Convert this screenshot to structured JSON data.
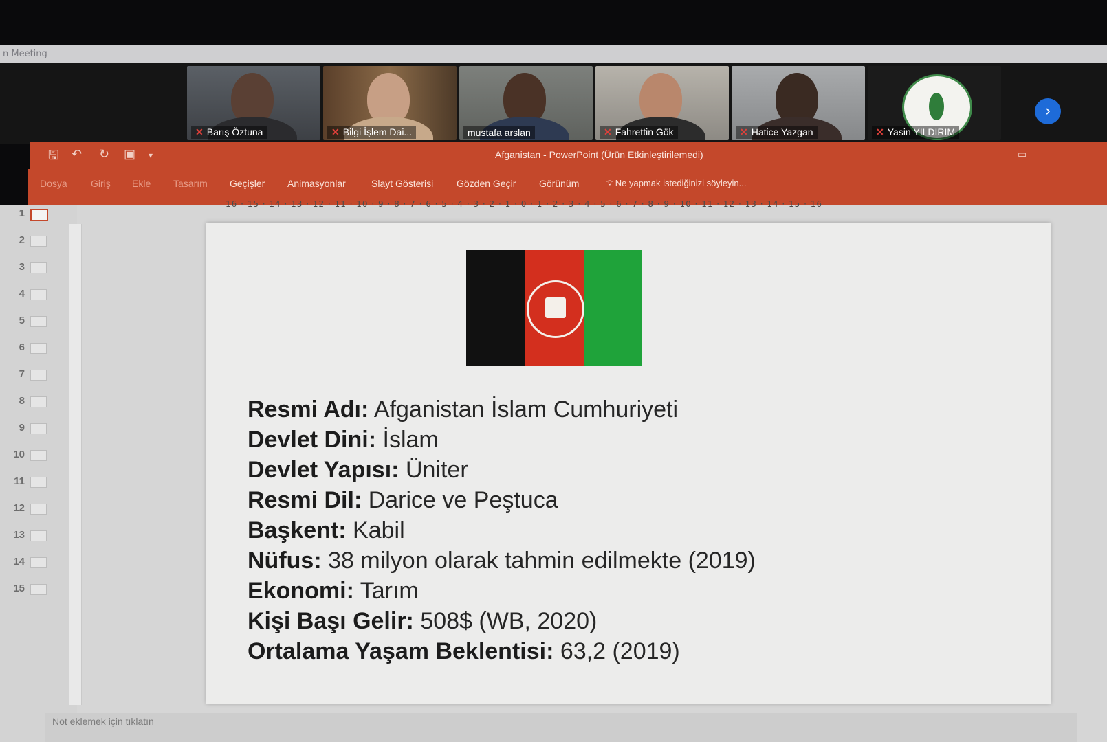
{
  "app": {
    "zoom_window_title": "n Meeting",
    "ppt_window_title": "Afganistan - PowerPoint (Ürün Etkinleştirilemedi)"
  },
  "participants": [
    {
      "name": "Barış Öztuna"
    },
    {
      "name": "Bilgi İşlem Dai..."
    },
    {
      "name": "mustafa arslan"
    },
    {
      "name": "Fahrettin Gök"
    },
    {
      "name": "Hatice Yazgan"
    },
    {
      "name": "Yasin YILDIRIM"
    }
  ],
  "quick_access": {
    "save_icon": "save-icon",
    "undo_icon": "undo-icon",
    "redo_icon": "redo-icon",
    "present_icon": "present-icon"
  },
  "ribbon": {
    "tabs": [
      {
        "label": "Dosya"
      },
      {
        "label": "Giriş"
      },
      {
        "label": "Ekle"
      },
      {
        "label": "Tasarım"
      },
      {
        "label": "Geçişler"
      },
      {
        "label": "Animasyonlar"
      },
      {
        "label": "Slayt Gösterisi"
      },
      {
        "label": "Gözden Geçir"
      },
      {
        "label": "Görünüm"
      }
    ],
    "tell_me": "Ne yapmak istediğinizi söyleyin..."
  },
  "ruler": {
    "text": "16 · 15 · 14 · 13 · 12 · 11 · 10 · 9 · 8 · 7 · 6 · 5 · 4 · 3 · 2 · 1 · 0 · 1 · 2 · 3 · 4 · 5 · 6 · 7 · 8 · 9 · 10 · 11 · 12 · 13 · 14 · 15 · 16"
  },
  "slide_thumbnails": [
    "1",
    "2",
    "3",
    "4",
    "5",
    "6",
    "7",
    "8",
    "9",
    "10",
    "11",
    "12",
    "13",
    "14",
    "15"
  ],
  "slide": {
    "flag_colors": [
      "#111111",
      "#d32f1e",
      "#1fa33a"
    ],
    "facts": [
      {
        "label": "Resmi Adı:",
        "value": " Afganistan İslam Cumhuriyeti"
      },
      {
        "label": "Devlet Dini:",
        "value": " İslam"
      },
      {
        "label": "Devlet Yapısı:",
        "value": " Üniter"
      },
      {
        "label": "Resmi Dil:",
        "value": " Darice ve Peştuca"
      },
      {
        "label": "Başkent:",
        "value": " Kabil"
      },
      {
        "label": "Nüfus:",
        "value": " 38 milyon olarak tahmin edilmekte (2019)"
      },
      {
        "label": "Ekonomi:",
        "value": " Tarım"
      },
      {
        "label": "Kişi Başı Gelir:",
        "value": " 508$ (WB, 2020)"
      },
      {
        "label": "Ortalama Yaşam Beklentisi:",
        "value": " 63,2 (2019)"
      }
    ]
  },
  "notes_placeholder": "Not eklemek için tıklatın"
}
